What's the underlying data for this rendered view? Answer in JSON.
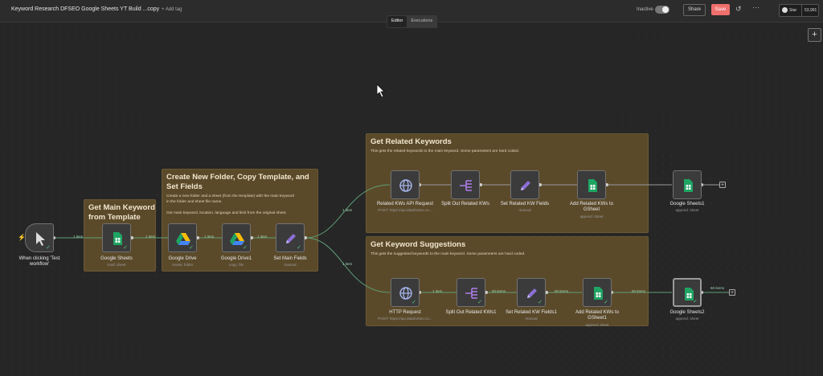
{
  "header": {
    "title": "Keyword Research DFSEO Google Sheets YT Build ...copy",
    "add_tag": "+ Add tag",
    "status_label": "Inactive",
    "share": "Share",
    "save": "Save",
    "github_star": "Star",
    "github_count": "53,991",
    "icons": [
      "history-icon",
      "more-icon",
      "github-icon"
    ]
  },
  "tabs": [
    "Editor",
    "Executions"
  ],
  "active_tab": "Editor",
  "colors": {
    "accent": "#ef6f6c",
    "sticky": "#5b4a2a",
    "success": "#56c97f",
    "sheets": "#1fa463",
    "expression": "#7e57c2"
  },
  "stickies": {
    "main": {
      "title_l1": "Get Main Keyword",
      "title_l2": "from Template"
    },
    "folder": {
      "title_l1": "Create New Folder, Copy Template, and",
      "title_l2": "Set Fields",
      "body_l1": "Create a new folder and a sheet (from the template) with the main keyword",
      "body_l2": "in the folder and sheet file name.",
      "body_l3": "Get main keyword, location, language and limit from the original sheet."
    },
    "related": {
      "title": "Get Related Keywords",
      "body": "This gets the related keywords to the main keyword. Some parameters are hard coded."
    },
    "suggest": {
      "title": "Get Keyword Suggestions",
      "body": "This gets the suggested keywords to the main keyword. Some parameters are hard coded."
    }
  },
  "nodes": {
    "trigger": {
      "l1": "When clicking 'Test",
      "l2": "workflow'"
    },
    "sheets": {
      "name": "Google Sheets",
      "sub": "read: sheet"
    },
    "drive": {
      "name": "Google Drive",
      "sub": "create: folder"
    },
    "drive1": {
      "name": "Google Drive1",
      "sub": "copy: file"
    },
    "setmain": {
      "name": "Set Main Fields",
      "sub": "manual"
    },
    "rel_api": {
      "name": "Related KWs API Request",
      "sub": "POST: https://api.dataforseo.co..."
    },
    "rel_split": {
      "name": "Split Out Related KWs"
    },
    "rel_set": {
      "name": "Set Related KW Fields",
      "sub": "manual"
    },
    "rel_add": {
      "l1": "Add Related KWs to",
      "l2": "GSheet",
      "sub": "append: sheet"
    },
    "sheets1": {
      "name": "Google Sheets1",
      "sub": "append: sheet"
    },
    "http": {
      "name": "HTTP Request",
      "sub": "POST: https://api.dataforseo.co..."
    },
    "sug_split": {
      "name": "Split Out Related KWs1"
    },
    "sug_set": {
      "name": "Set Related KW Fields1",
      "sub": "manual"
    },
    "sug_add": {
      "l1": "Add Related KWs to",
      "l2": "GSheet1",
      "sub": "append: sheet"
    },
    "sheets2": {
      "name": "Google Sheets2",
      "sub": "append: sheet"
    }
  },
  "items": {
    "e1": "1 item",
    "e2": "1 item",
    "e3": "1 item",
    "e4": "1 item",
    "rel": "1 item",
    "sug": "1 item",
    "s1": "1 item",
    "s2": "50 items",
    "s3": "50 items",
    "s4": "50 items",
    "end": "50 items"
  }
}
